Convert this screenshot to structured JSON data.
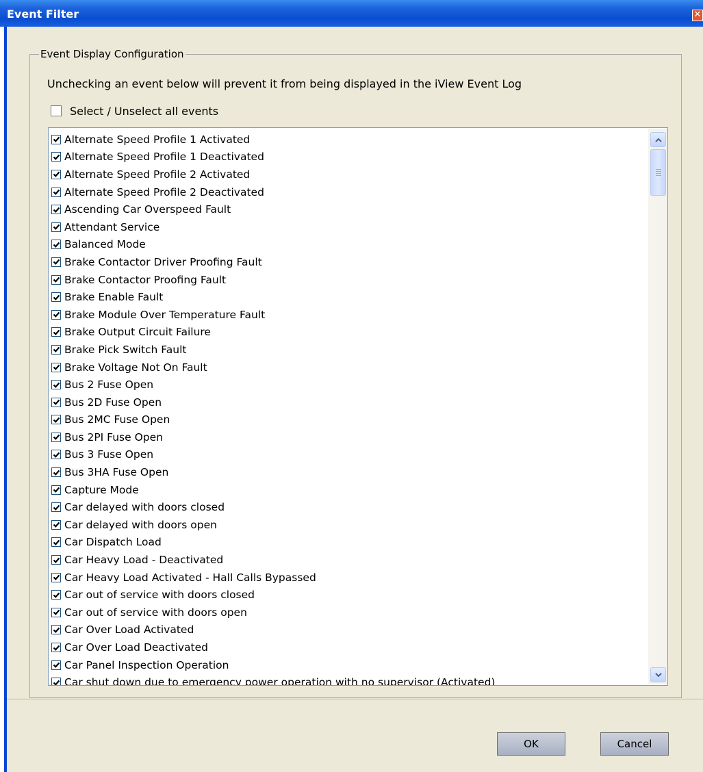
{
  "window": {
    "title": "Event Filter",
    "close_glyph": "✕"
  },
  "group": {
    "legend": "Event Display Configuration",
    "instruction": "Unchecking an event below will prevent it from being displayed in the iView Event Log",
    "select_all_label": "Select / Unselect all events",
    "select_all_checked": false
  },
  "events": [
    {
      "label": "Alternate Speed Profile 1 Activated",
      "checked": true
    },
    {
      "label": "Alternate Speed Profile 1 Deactivated",
      "checked": true
    },
    {
      "label": "Alternate Speed Profile 2 Activated",
      "checked": true
    },
    {
      "label": "Alternate Speed Profile 2 Deactivated",
      "checked": true
    },
    {
      "label": "Ascending Car Overspeed Fault",
      "checked": true
    },
    {
      "label": "Attendant Service",
      "checked": true
    },
    {
      "label": "Balanced Mode",
      "checked": true
    },
    {
      "label": "Brake Contactor Driver Proofing Fault",
      "checked": true
    },
    {
      "label": "Brake Contactor Proofing Fault",
      "checked": true
    },
    {
      "label": "Brake Enable Fault",
      "checked": true
    },
    {
      "label": "Brake Module Over Temperature Fault",
      "checked": true
    },
    {
      "label": "Brake Output Circuit Failure",
      "checked": true
    },
    {
      "label": "Brake Pick Switch Fault",
      "checked": true
    },
    {
      "label": "Brake Voltage Not On Fault",
      "checked": true
    },
    {
      "label": "Bus 2 Fuse Open",
      "checked": true
    },
    {
      "label": "Bus 2D Fuse Open",
      "checked": true
    },
    {
      "label": "Bus 2MC Fuse Open",
      "checked": true
    },
    {
      "label": "Bus 2PI Fuse Open",
      "checked": true
    },
    {
      "label": "Bus 3 Fuse Open",
      "checked": true
    },
    {
      "label": "Bus 3HA Fuse Open",
      "checked": true
    },
    {
      "label": "Capture Mode",
      "checked": true
    },
    {
      "label": "Car delayed with doors closed",
      "checked": true
    },
    {
      "label": "Car delayed with doors open",
      "checked": true
    },
    {
      "label": "Car Dispatch Load",
      "checked": true
    },
    {
      "label": "Car Heavy Load - Deactivated",
      "checked": true
    },
    {
      "label": "Car Heavy Load Activated - Hall Calls Bypassed",
      "checked": true
    },
    {
      "label": "Car out of service with doors closed",
      "checked": true
    },
    {
      "label": "Car out of service with doors open",
      "checked": true
    },
    {
      "label": "Car Over Load Activated",
      "checked": true
    },
    {
      "label": "Car Over Load Deactivated",
      "checked": true
    },
    {
      "label": "Car Panel Inspection Operation",
      "checked": true
    },
    {
      "label": "Car shut down due to emergency power operation with no supervisor (Activated)",
      "checked": true
    }
  ],
  "buttons": {
    "ok": "OK",
    "cancel": "Cancel"
  },
  "icons": {
    "check": "check-icon",
    "scroll_up": "arrow-up-icon",
    "scroll_down": "arrow-down-icon",
    "close": "close-icon"
  }
}
